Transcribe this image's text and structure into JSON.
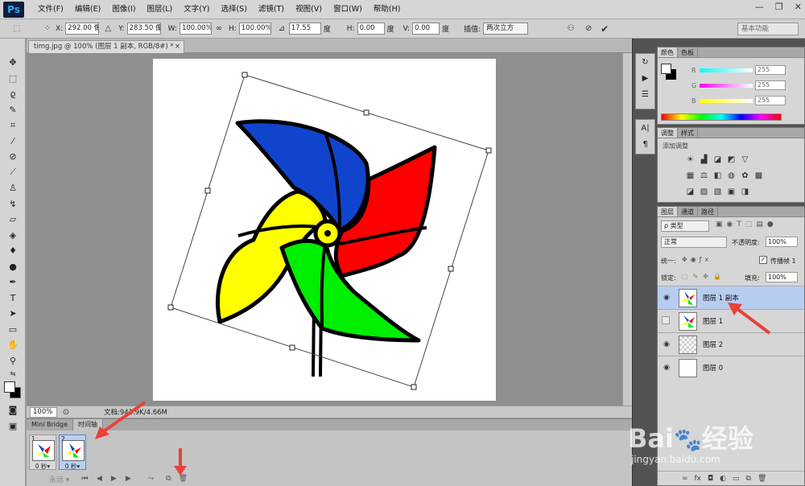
{
  "app": {
    "logo": "Ps"
  },
  "menu": [
    "文件(F)",
    "编辑(E)",
    "图像(I)",
    "图层(L)",
    "文字(Y)",
    "选择(S)",
    "滤镜(T)",
    "视图(V)",
    "窗口(W)",
    "帮助(H)"
  ],
  "window_controls": {
    "minimize": "—",
    "restore": "❐",
    "close": "✕"
  },
  "options": {
    "x_label": "X:",
    "x_value": "292.00 像素",
    "y_label": "Y:",
    "y_value": "283.50 像素",
    "w_label": "W:",
    "w_value": "100.00%",
    "h_label": "H:",
    "h_value": "100.00%",
    "angle_value": "17.55",
    "angle_unit": "度",
    "hskew_label": "H:",
    "hskew_value": "0.00",
    "hskew_unit": "度",
    "vskew_label": "V:",
    "vskew_value": "0.00",
    "vskew_unit": "度",
    "interp_label": "插值:",
    "interp_value": "两次立方",
    "workspace": "基本功能"
  },
  "document": {
    "tab_title": "timg.jpg @ 100% (图层 1 副本, RGB/8#) *",
    "tab_close": "×",
    "zoom": "100%",
    "doc_info": "文档:941.9K/4.66M"
  },
  "timeline": {
    "tabs": [
      "Mini Bridge",
      "时间轴"
    ],
    "frames": [
      {
        "num": "1",
        "delay": "0 秒▾"
      },
      {
        "num": "2",
        "delay": "0 秒▾"
      }
    ],
    "loop": "永远 ▾"
  },
  "color_panel": {
    "tabs": [
      "颜色",
      "色板"
    ],
    "r_label": "R",
    "r_value": "255",
    "g_label": "G",
    "g_value": "255",
    "b_label": "B",
    "b_value": "255"
  },
  "adjust_panel": {
    "tabs": [
      "调整",
      "样式"
    ],
    "title": "添加调整"
  },
  "layers_panel": {
    "tabs": [
      "图层",
      "通道",
      "路径"
    ],
    "filter": "ρ 类型",
    "blend_mode": "正常",
    "opacity_label": "不透明度:",
    "opacity_value": "100%",
    "unify_label": "统一:",
    "propagate_label": "传播帧 1",
    "lock_label": "锁定:",
    "fill_label": "填充:",
    "fill_value": "100%",
    "layers": [
      {
        "name": "图层 1 副本",
        "visible": true,
        "selected": true
      },
      {
        "name": "图层 1",
        "visible": false,
        "selected": false
      },
      {
        "name": "图层 2",
        "visible": true,
        "selected": false
      },
      {
        "name": "图层 0",
        "visible": true,
        "selected": false
      }
    ],
    "bottom_icons": [
      "link-icon",
      "fx-icon",
      "mask-icon",
      "adjustment-icon",
      "group-icon",
      "new-layer-icon",
      "trash-icon"
    ]
  },
  "watermark": {
    "brand": "Bai",
    "cn": "经验",
    "url": "jingyan.baidu.com"
  },
  "colors": {
    "accent_arrow": "#e8423a",
    "selection": "#b7cdf0"
  }
}
